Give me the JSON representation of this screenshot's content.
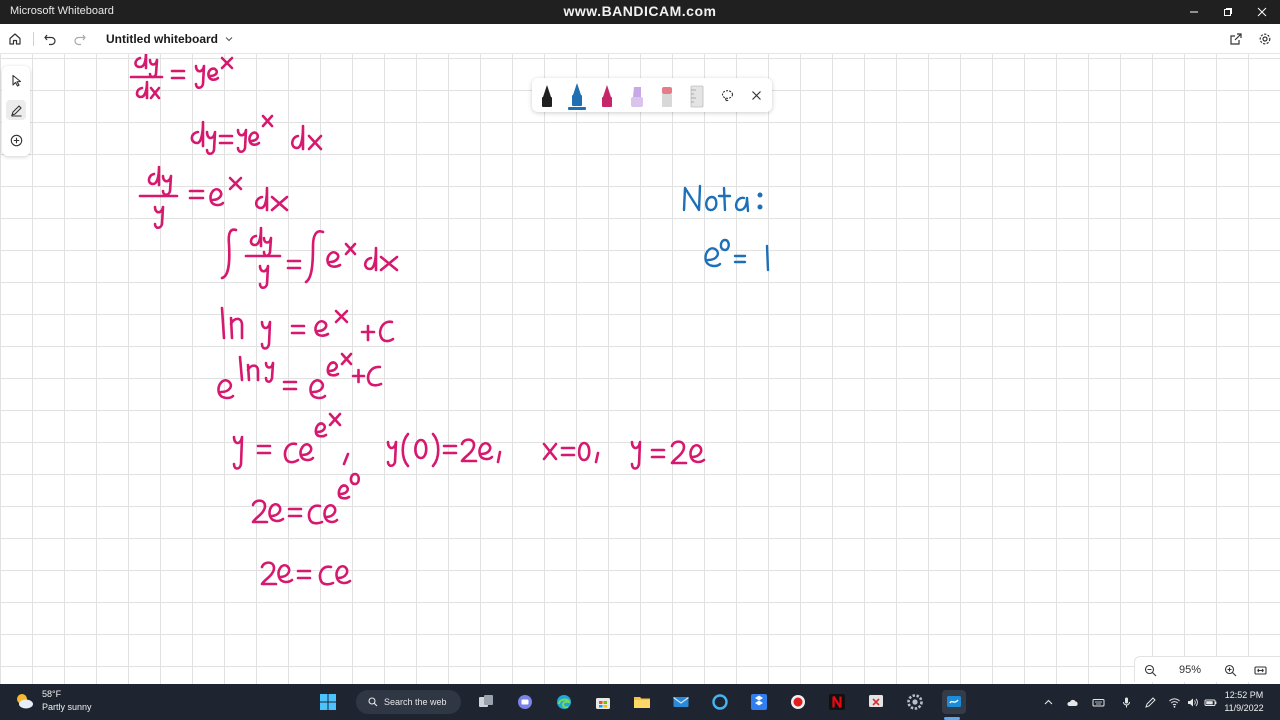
{
  "window": {
    "title": "Microsoft Whiteboard",
    "watermark": "www.BANDICAM.com"
  },
  "header": {
    "doc_title": "Untitled whiteboard",
    "icons": [
      "home-icon",
      "undo-icon",
      "redo-icon",
      "chevron-down-icon",
      "share-icon",
      "settings-icon"
    ]
  },
  "rail": {
    "tools": [
      "select-icon",
      "pen-icon",
      "add-icon"
    ],
    "active": "pen-icon"
  },
  "pen_tray": {
    "pens": [
      {
        "name": "black",
        "color": "#202020"
      },
      {
        "name": "blue",
        "color": "#1f6fb2"
      },
      {
        "name": "magenta",
        "color": "#c7256a"
      },
      {
        "name": "highlighter-lavender",
        "color": "#c9a8e8"
      },
      {
        "name": "eraser",
        "color": "#e57c8a"
      },
      {
        "name": "ruler",
        "color": "#c8c8c8"
      }
    ],
    "selected": "blue"
  },
  "zoom": {
    "value": "95%"
  },
  "ink_colors": {
    "magenta": "#d6186e",
    "blue": "#1d6fb8"
  },
  "taskbar": {
    "weather_temp": "58°F",
    "weather_desc": "Partly sunny",
    "search_label": "Search the web",
    "time": "12:52 PM",
    "date": "11/9/2022"
  }
}
